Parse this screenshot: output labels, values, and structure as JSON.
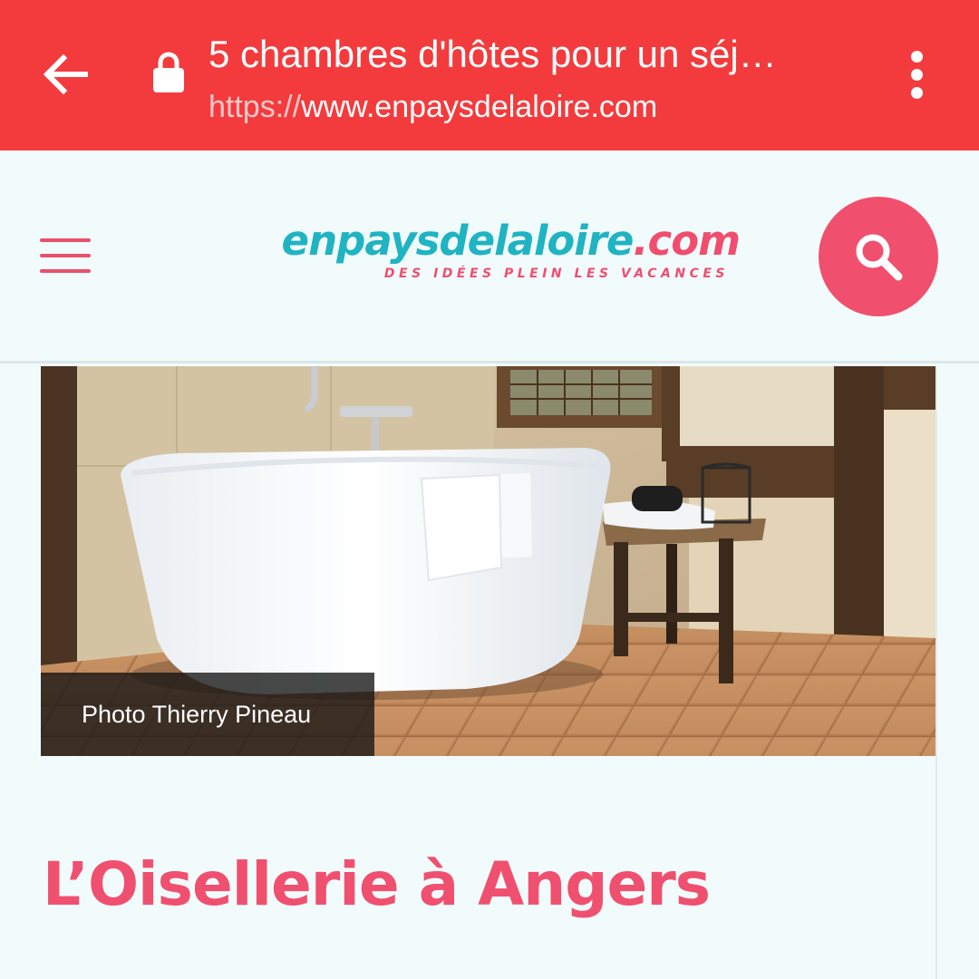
{
  "browser": {
    "page_title": "5 chambres d'hôtes pour un séj…",
    "url_scheme": "https://",
    "url_host": "www.enpaysdelaloire.com",
    "bar_color": "#f33b3d"
  },
  "icons": {
    "back": "arrow-back-icon",
    "lock": "lock-icon",
    "menu": "more-vert-icon",
    "hamburger": "hamburger-menu-icon",
    "search": "search-icon"
  },
  "site": {
    "logo_part1": "enpaysdelaloire",
    "logo_part2": ".com",
    "logo_tagline": "DES IDÉES PLEIN LES VACANCES",
    "brand_teal": "#20b3c2",
    "brand_pink": "#f0506f"
  },
  "article": {
    "photo_credit": "Photo Thierry Pineau",
    "title": "L’Oisellerie à Angers"
  }
}
